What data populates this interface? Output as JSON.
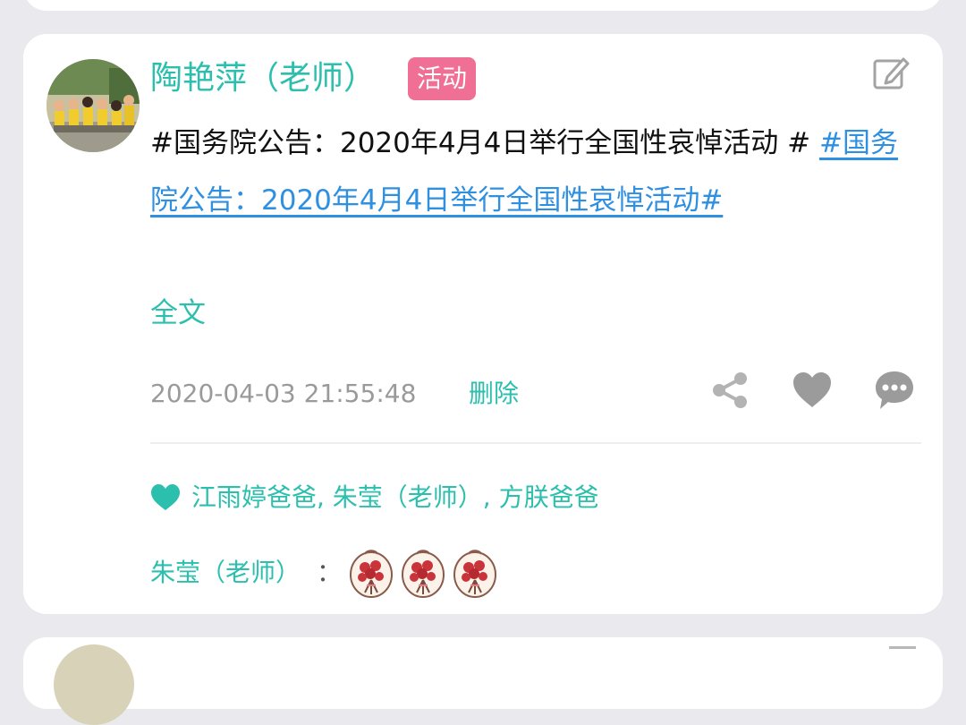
{
  "post": {
    "author": "陶艳萍（老师）",
    "badge": "活动",
    "text_prefix": "#国务院公告：2020年4月4日举行全国性哀悼活动 #",
    "topic_link": "#国务院公告：2020年4月4日举行全国性哀悼活动#",
    "full_text_label": "全文",
    "timestamp": "2020-04-03 21:55:48",
    "delete_label": "删除"
  },
  "likes": {
    "names": "江雨婷爸爸, 朱莹（老师）, 方朕爸爸"
  },
  "comments": [
    {
      "author": "朱莹（老师）",
      "colon": "：",
      "emoji_count": 3
    }
  ],
  "icons": {
    "edit": "edit-icon",
    "share": "share-icon",
    "like": "heart-icon",
    "comment": "comment-bubble-icon",
    "likes_marker": "heart-icon",
    "comment_emoji": "rose-bouquet-icon"
  },
  "colors": {
    "accent": "#2bbfad",
    "badge": "#f06f94",
    "link": "#2f8fe0",
    "muted": "#9a9a9a",
    "background": "#e9e9ee"
  }
}
